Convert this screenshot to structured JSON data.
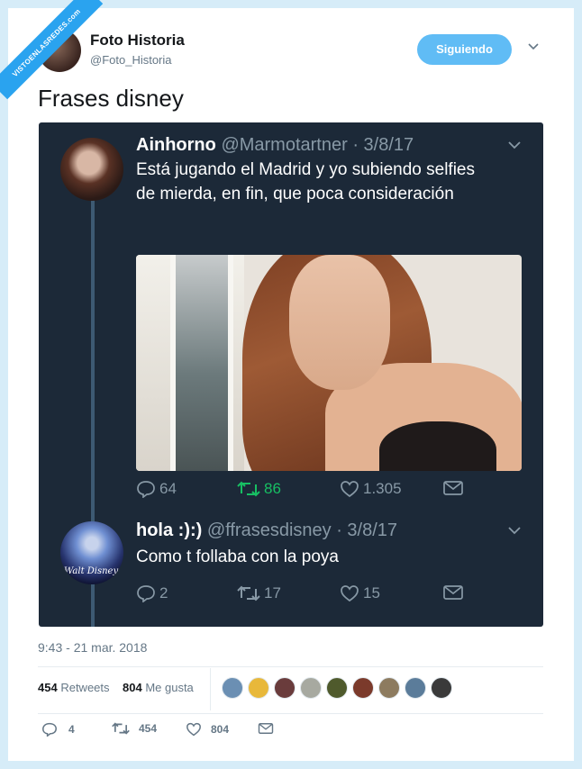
{
  "watermark": "VISTOENLASREDES.com",
  "author": {
    "name": "Foto Historia",
    "handle": "@Foto_Historia",
    "follow_label": "Siguiendo"
  },
  "tweet_text": "Frases disney",
  "quoted_thread": [
    {
      "name": "Ainhorno",
      "handle": "@Marmotartner",
      "date": "· 3/8/17",
      "text": "Está jugando el Madrid y yo subiendo selfies de mierda, en fin, que poca consideración",
      "replies": "64",
      "retweets": "86",
      "likes": "1.305",
      "retweeted": true
    },
    {
      "name": "hola :):)",
      "handle": "@ffrasesdisney",
      "date": "· 3/8/17",
      "text": "Como t follaba con la poya",
      "avatar_text": "Walt Disney",
      "replies": "2",
      "retweets": "17",
      "likes": "15",
      "retweeted": false
    }
  ],
  "timestamp": "9:43 - 21 mar. 2018",
  "stats": {
    "retweets_count": "454",
    "retweets_label": "Retweets",
    "likes_count": "804",
    "likes_label": "Me gusta"
  },
  "liker_colors": [
    "#6b8fb3",
    "#e8b83a",
    "#6a3c3c",
    "#a7a9a0",
    "#4f5a2c",
    "#7b3a2b",
    "#8d7b5f",
    "#5b7c9a",
    "#3a3a3a"
  ],
  "bottom_actions": {
    "replies": "4",
    "retweets": "454",
    "likes": "804"
  },
  "colors": {
    "accent": "#1da1f2",
    "dark_bg": "#1c2938",
    "retweet_green": "#17bf63"
  }
}
